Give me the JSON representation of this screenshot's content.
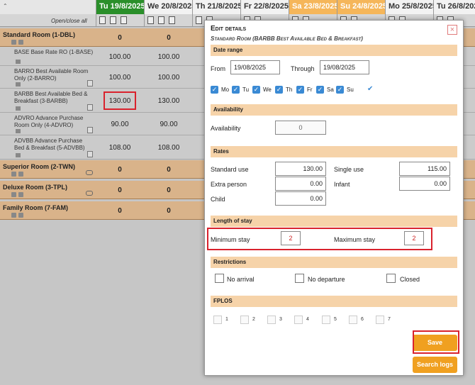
{
  "grid": {
    "open_close_all": "Open/close all",
    "dates": [
      {
        "label": "Tu 19/8/2025",
        "kind": "today"
      },
      {
        "label": "We 20/8/2025",
        "kind": "wd"
      },
      {
        "label": "Th 21/8/2025",
        "kind": "wd"
      },
      {
        "label": "Fr 22/8/2025",
        "kind": "wd"
      },
      {
        "label": "Sa 23/8/2025",
        "kind": "we"
      },
      {
        "label": "Su 24/8/2025",
        "kind": "we"
      },
      {
        "label": "Mo 25/8/2025",
        "kind": "wd"
      },
      {
        "label": "Tu 26/8/2025",
        "kind": "wd"
      }
    ],
    "rooms": [
      {
        "name": "Standard Room (1-DBL)",
        "v1": "0",
        "v2": "0"
      },
      {
        "name": "Superior Room (2-TWN)",
        "v1": "0",
        "v2": "0"
      },
      {
        "name": "Deluxe Room (3-TPL)",
        "v1": "0",
        "v2": "0"
      },
      {
        "name": "Family Room (7-FAM)",
        "v1": "0",
        "v2": "0"
      }
    ],
    "rates": [
      {
        "name": "BASE Base Rate RO (1-BASE)",
        "v1": "100.00",
        "v2": "100.00"
      },
      {
        "name": "BARRO Best Available Room Only (2-BARRO)",
        "v1": "100.00",
        "v2": "100.00"
      },
      {
        "name": "BARBB Best Available Bed & Breakfast (3-BARBB)",
        "v1": "130.00",
        "v2": "130.00"
      },
      {
        "name": "ADVRO Advance Purchase Room Only (4-ADVRO)",
        "v1": "90.00",
        "v2": "90.00"
      },
      {
        "name": "ADVBB Advance Purchase Bed & Breakfast (5-ADVBB)",
        "v1": "108.00",
        "v2": "108.00"
      }
    ]
  },
  "modal": {
    "title": "Edit details",
    "subtitle": "Standard Room (BARBB Best Available Bed & Breakfast)",
    "close": "×",
    "date_range": {
      "heading": "Date range",
      "from_label": "From",
      "from_value": "19/08/2025",
      "through_label": "Through",
      "through_value": "19/08/2025",
      "days": [
        "Mo",
        "Tu",
        "We",
        "Th",
        "Fr",
        "Sa",
        "Su"
      ]
    },
    "availability": {
      "heading": "Availability",
      "label": "Availability",
      "value": "0"
    },
    "rates": {
      "heading": "Rates",
      "standard_label": "Standard use",
      "standard_value": "130.00",
      "single_label": "Single use",
      "single_value": "115.00",
      "extra_label": "Extra person",
      "extra_value": "0.00",
      "infant_label": "Infant",
      "infant_value": "0.00",
      "child_label": "Child",
      "child_value": "0.00"
    },
    "length_of_stay": {
      "heading": "Length of stay",
      "min_label": "Minimum stay",
      "min_value": "2",
      "max_label": "Maximum stay",
      "max_value": "2"
    },
    "restrictions": {
      "heading": "Restrictions",
      "no_arrival": "No arrival",
      "no_departure": "No departure",
      "closed": "Closed"
    },
    "fplos": {
      "heading": "FPLOS",
      "items": [
        "1",
        "2",
        "3",
        "4",
        "5",
        "6",
        "7"
      ]
    },
    "save_label": "Save",
    "search_logs_label": "Search logs"
  },
  "colors": {
    "today": "#2a8f2a",
    "weekend": "#f5b65a",
    "room_row": "#d9b38a",
    "section": "#f6d3a9",
    "accent_button": "#f0a020",
    "highlight": "#d9222d",
    "checkbox": "#3a8ad4"
  }
}
